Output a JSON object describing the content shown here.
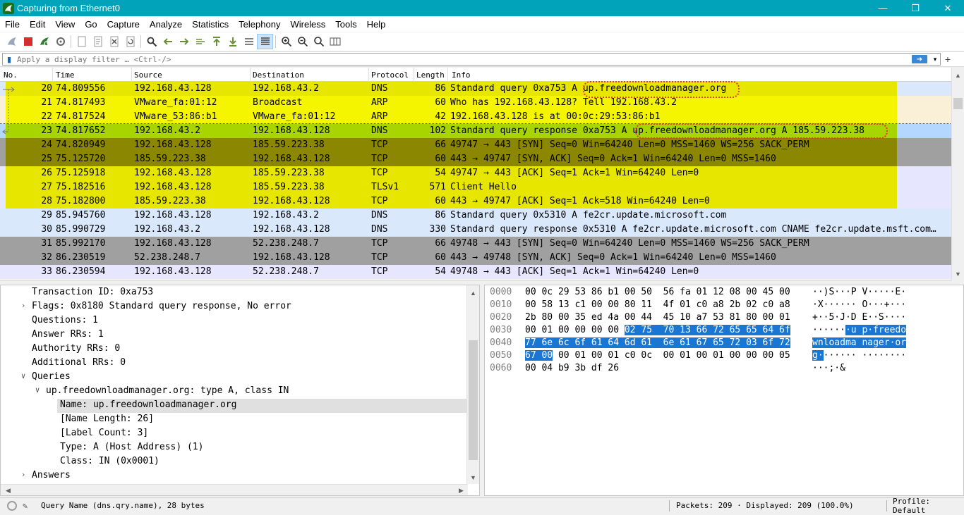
{
  "window": {
    "title": "Capturing from Ethernet0",
    "minimize": "—",
    "restore": "❐",
    "close": "✕"
  },
  "menu": [
    "File",
    "Edit",
    "View",
    "Go",
    "Capture",
    "Analyze",
    "Statistics",
    "Telephony",
    "Wireless",
    "Tools",
    "Help"
  ],
  "filter": {
    "placeholder": "Apply a display filter … <Ctrl-/>",
    "apply_icon": "arrow-right-icon",
    "plus": "+"
  },
  "columns": {
    "no": "No.",
    "time": "Time",
    "source": "Source",
    "destination": "Destination",
    "protocol": "Protocol",
    "length": "Length",
    "info": "Info"
  },
  "packets": [
    {
      "no": "20",
      "time": "74.809556",
      "src": "192.168.43.128",
      "dst": "192.168.43.2",
      "proto": "DNS",
      "len": "86",
      "info": "Standard query 0xa753 A up.freedownloadmanager.org",
      "bg": "#e7e600",
      "rowbg": "#dae8fc"
    },
    {
      "no": "21",
      "time": "74.817493",
      "src": "VMware_fa:01:12",
      "dst": "Broadcast",
      "proto": "ARP",
      "len": "60",
      "info": "Who has 192.168.43.128? Tell 192.168.43.2",
      "bg": "#f5f500",
      "rowbg": "#faf0d7"
    },
    {
      "no": "22",
      "time": "74.817524",
      "src": "VMware_53:86:b1",
      "dst": "VMware_fa:01:12",
      "proto": "ARP",
      "len": "42",
      "info": "192.168.43.128 is at 00:0c:29:53:86:b1",
      "bg": "#f5f500",
      "rowbg": "#faf0d7"
    },
    {
      "no": "23",
      "time": "74.817652",
      "src": "192.168.43.2",
      "dst": "192.168.43.128",
      "proto": "DNS",
      "len": "102",
      "info": "Standard query response 0xa753 A up.freedownloadmanager.org A 185.59.223.38",
      "bg": "#a8d500",
      "rowbg": "#b3d7ff"
    },
    {
      "no": "24",
      "time": "74.820949",
      "src": "192.168.43.128",
      "dst": "185.59.223.38",
      "proto": "TCP",
      "len": "66",
      "info": "49747 → 443 [SYN] Seq=0 Win=64240 Len=0 MSS=1460 WS=256 SACK_PERM",
      "bg": "#8b8700",
      "rowbg": "#a0a0a0"
    },
    {
      "no": "25",
      "time": "75.125720",
      "src": "185.59.223.38",
      "dst": "192.168.43.128",
      "proto": "TCP",
      "len": "60",
      "info": "443 → 49747 [SYN, ACK] Seq=0 Ack=1 Win=64240 Len=0 MSS=1460",
      "bg": "#8b8700",
      "rowbg": "#a0a0a0"
    },
    {
      "no": "26",
      "time": "75.125918",
      "src": "192.168.43.128",
      "dst": "185.59.223.38",
      "proto": "TCP",
      "len": "54",
      "info": "49747 → 443 [ACK] Seq=1 Ack=1 Win=64240 Len=0",
      "bg": "#e7e600",
      "rowbg": "#e7e6ff"
    },
    {
      "no": "27",
      "time": "75.182516",
      "src": "192.168.43.128",
      "dst": "185.59.223.38",
      "proto": "TLSv1",
      "len": "571",
      "info": "Client Hello",
      "bg": "#e7e600",
      "rowbg": "#e7e6ff"
    },
    {
      "no": "28",
      "time": "75.182800",
      "src": "185.59.223.38",
      "dst": "192.168.43.128",
      "proto": "TCP",
      "len": "60",
      "info": "443 → 49747 [ACK] Seq=1 Ack=518 Win=64240 Len=0",
      "bg": "#e7e600",
      "rowbg": "#e7e6ff"
    },
    {
      "no": "29",
      "time": "85.945760",
      "src": "192.168.43.128",
      "dst": "192.168.43.2",
      "proto": "DNS",
      "len": "86",
      "info": "Standard query 0x5310 A fe2cr.update.microsoft.com",
      "bg": "#dae8fc",
      "rowbg": "#dae8fc"
    },
    {
      "no": "30",
      "time": "85.990729",
      "src": "192.168.43.2",
      "dst": "192.168.43.128",
      "proto": "DNS",
      "len": "330",
      "info": "Standard query response 0x5310 A fe2cr.update.microsoft.com CNAME fe2cr.update.msft.com…",
      "bg": "#dae8fc",
      "rowbg": "#dae8fc"
    },
    {
      "no": "31",
      "time": "85.992170",
      "src": "192.168.43.128",
      "dst": "52.238.248.7",
      "proto": "TCP",
      "len": "66",
      "info": "49748 → 443 [SYN] Seq=0 Win=64240 Len=0 MSS=1460 WS=256 SACK_PERM",
      "bg": "#a0a0a0",
      "rowbg": "#a0a0a0"
    },
    {
      "no": "32",
      "time": "86.230519",
      "src": "52.238.248.7",
      "dst": "192.168.43.128",
      "proto": "TCP",
      "len": "60",
      "info": "443 → 49748 [SYN, ACK] Seq=0 Ack=1 Win=64240 Len=0 MSS=1460",
      "bg": "#a0a0a0",
      "rowbg": "#a0a0a0"
    },
    {
      "no": "33",
      "time": "86.230594",
      "src": "192.168.43.128",
      "dst": "52.238.248.7",
      "proto": "TCP",
      "len": "54",
      "info": "49748 → 443 [ACK] Seq=1 Ack=1 Win=64240 Len=0",
      "bg": "#e7e6ff",
      "rowbg": "#e7e6ff"
    }
  ],
  "details": [
    {
      "text": "Transaction ID: 0xa753",
      "arrow": ""
    },
    {
      "text": "Flags: 0x8180 Standard query response, No error",
      "arrow": "›"
    },
    {
      "text": "Questions: 1",
      "arrow": ""
    },
    {
      "text": "Answer RRs: 1",
      "arrow": ""
    },
    {
      "text": "Authority RRs: 0",
      "arrow": ""
    },
    {
      "text": "Additional RRs: 0",
      "arrow": ""
    },
    {
      "text": "Queries",
      "arrow": "∨"
    },
    {
      "text": "up.freedownloadmanager.org: type A, class IN",
      "arrow": "∨"
    },
    {
      "text": "Name: up.freedownloadmanager.org",
      "arrow": ""
    },
    {
      "text": "[Name Length: 26]",
      "arrow": ""
    },
    {
      "text": "[Label Count: 3]",
      "arrow": ""
    },
    {
      "text": "Type: A (Host Address) (1)",
      "arrow": ""
    },
    {
      "text": "Class: IN (0x0001)",
      "arrow": ""
    },
    {
      "text": "Answers",
      "arrow": "›"
    }
  ],
  "bytes": [
    {
      "off": "0000",
      "hex": "00 0c 29 53 86 b1 00 50  56 fa 01 12 08 00 45 00",
      "asc": "··)S···P V·····E·"
    },
    {
      "off": "0010",
      "hex": "00 58 13 c1 00 00 80 11  4f 01 c0 a8 2b 02 c0 a8",
      "asc": "·X······ O···+···"
    },
    {
      "off": "0020",
      "hex": "2b 80 00 35 ed 4a 00 44  45 10 a7 53 81 80 00 01",
      "asc": "+··5·J·D E··S····"
    },
    {
      "off": "0030",
      "hex": "00 01 00 00 00 00 ",
      "hexhl": "02 75  70 13 66 72 65 65 64 6f",
      "asc": "",
      "aschl_pre": "······",
      "aschl": "·u p·freedo"
    },
    {
      "off": "0040",
      "hexhl": "77 6e 6c 6f 61 64 6d 61  6e 61 67 65 72 03 6f 72",
      "aschl": "wnloadma nager·or"
    },
    {
      "off": "0050",
      "hexhl": "67 00",
      "hex": " 00 01 00 01 c0 0c  00 01 00 01 00 00 00 05",
      "aschl": "g·",
      "asc": "······ ········"
    },
    {
      "off": "0060",
      "hex": "00 04 b9 3b df 26",
      "asc": "···;·&"
    }
  ],
  "status": {
    "field": "Query Name (dns.qry.name), 28 bytes",
    "packets": "Packets: 209 · Displayed: 209 (100.0%)",
    "profile": "Profile: Default"
  },
  "colors": {
    "titlebar": "#00a3b9",
    "highlight": "#1976d2",
    "annotation": "#e53935"
  }
}
